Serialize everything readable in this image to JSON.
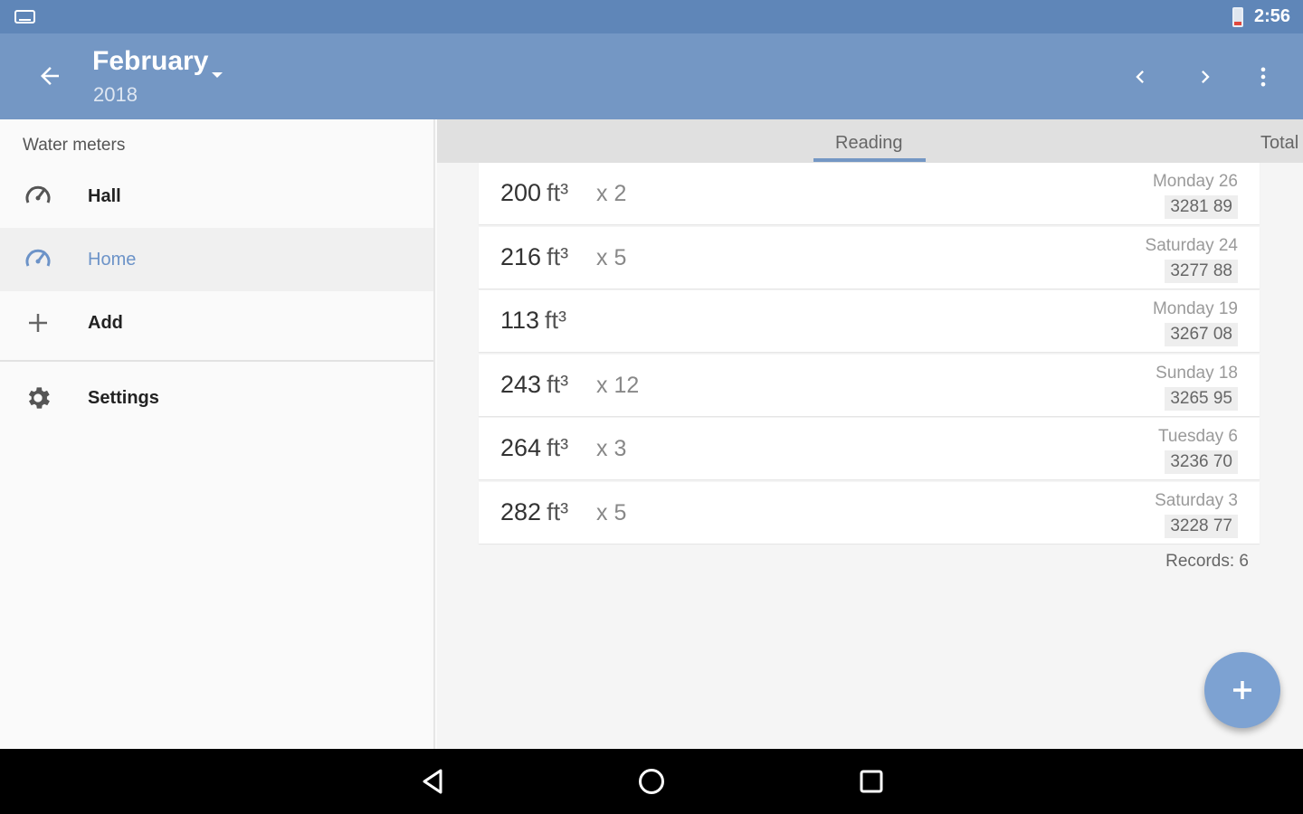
{
  "status_bar": {
    "time": "2:56"
  },
  "toolbar": {
    "title": "February",
    "subtitle": "2018",
    "icons": {
      "back": "arrow-back-icon",
      "dropdown": "dropdown-arrow-icon",
      "prev": "chevron-left-icon",
      "next": "chevron-right-icon",
      "more": "more-vert-icon"
    }
  },
  "sidebar": {
    "section_label": "Water meters",
    "items": [
      {
        "label": "Hall",
        "icon": "speedometer-icon"
      },
      {
        "label": "Home",
        "icon": "speedometer-icon",
        "selected": true
      },
      {
        "label": "Add",
        "icon": "plus-icon"
      },
      {
        "label": "Settings",
        "icon": "gear-icon"
      }
    ]
  },
  "tabs": [
    {
      "label": "Reading",
      "active": true
    },
    {
      "label": "Total"
    }
  ],
  "records": [
    {
      "value": "200",
      "unit": "ft³",
      "multiplier": "x 2",
      "date": "Monday 26",
      "reading": "3281 89"
    },
    {
      "value": "216",
      "unit": "ft³",
      "multiplier": "x 5",
      "date": "Saturday 24",
      "reading": "3277 88"
    },
    {
      "value": "113",
      "unit": "ft³",
      "multiplier": "",
      "date": "Monday 19",
      "reading": "3267 08"
    },
    {
      "value": "243",
      "unit": "ft³",
      "multiplier": "x 12",
      "date": "Sunday 18",
      "reading": "3265 95"
    },
    {
      "value": "264",
      "unit": "ft³",
      "multiplier": "x 3",
      "date": "Tuesday 6",
      "reading": "3236 70"
    },
    {
      "value": "282",
      "unit": "ft³",
      "multiplier": "x 5",
      "date": "Saturday 3",
      "reading": "3228 77"
    }
  ],
  "records_count": "Records: 6",
  "colors": {
    "status_bar": "#5f86b8",
    "toolbar": "#7497c4",
    "accent": "#7da2d2",
    "selected_text": "#6c93c8"
  }
}
